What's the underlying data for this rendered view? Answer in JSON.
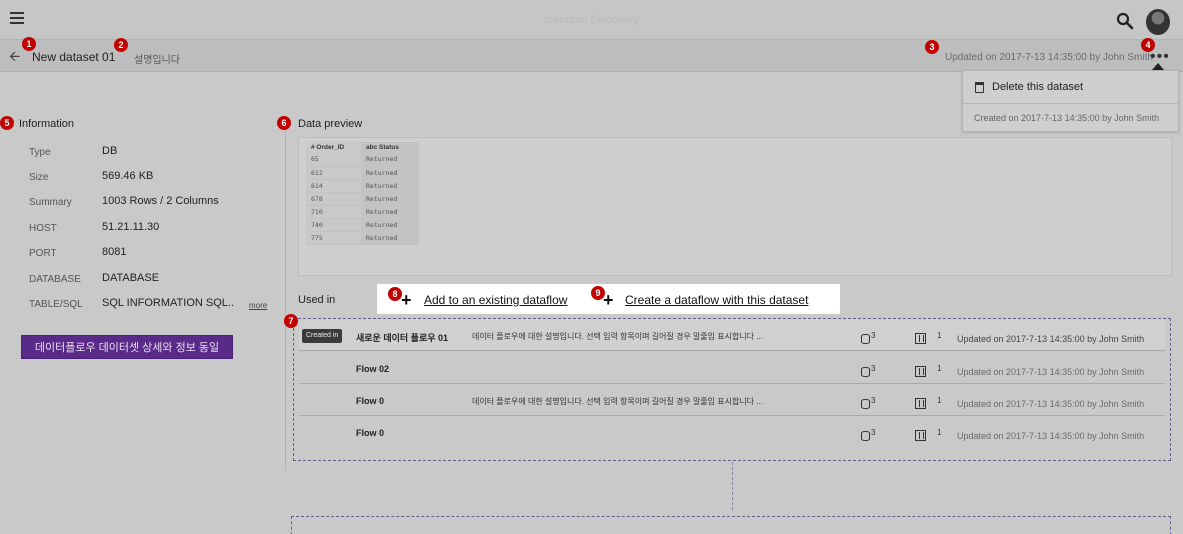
{
  "app": {
    "brand": "metatron Discovery"
  },
  "header": {
    "title": "New dataset 01",
    "description": "설명입니다",
    "updated": "Updated on 2017-7-13 14:35:00 by John Smith",
    "more": "•••"
  },
  "badges": [
    "1",
    "2",
    "3",
    "4",
    "5",
    "6",
    "7",
    "8",
    "9"
  ],
  "menu": {
    "delete_label": "Delete this dataset",
    "created": "Created on 2017-7-13 14:35:00 by John Smith"
  },
  "info": {
    "title": "Information",
    "rows": [
      {
        "label": "Type",
        "value": "DB"
      },
      {
        "label": "Size",
        "value": "569.46 KB"
      },
      {
        "label": "Summary",
        "value": "1003 Rows / 2 Columns"
      },
      {
        "label": "HOST",
        "value": "51.21.11.30"
      },
      {
        "label": "PORT",
        "value": "8081"
      },
      {
        "label": "DATABASE",
        "value": "DATABASE"
      },
      {
        "label": "TABLE/SQL",
        "value": "SQL INFORMATION SQL.."
      }
    ],
    "more_link": "more",
    "button": "데이터플로우 데이터셋 상세와 정보 동일"
  },
  "preview": {
    "title": "Data preview",
    "columns": [
      "# Order_ID",
      "abc Status"
    ],
    "rows": [
      [
        "65",
        "Returned"
      ],
      [
        "612",
        "Returned"
      ],
      [
        "614",
        "Returned"
      ],
      [
        "678",
        "Returned"
      ],
      [
        "710",
        "Returned"
      ],
      [
        "740",
        "Returned"
      ],
      [
        "775",
        "Returned"
      ]
    ]
  },
  "used_in": {
    "title": "Used in",
    "add_existing": "Add to an existing dataflow",
    "create_new": "Create a dataflow with this dataset",
    "created_tag": "Created in",
    "flows": [
      {
        "name": "새로운 데이터 플로우 01",
        "desc": "데이터 플로우에 대한 설명입니다. 선택 입력 항목이며 길어질 경우 말줄임 표시합니다 ...",
        "datasets": "3",
        "tables": "1",
        "updated": "Updated on 2017-7-13 14:35:00 by John Smith"
      },
      {
        "name": "Flow 02",
        "desc": "",
        "datasets": "3",
        "tables": "1",
        "updated": "Updated on 2017-7-13 14:35:00 by John Smith"
      },
      {
        "name": "Flow 0",
        "desc": "데이터 플로우에 대한 설명입니다. 선택 입력 항목이며 길어질 경우 말줄임 표시합니다 ...",
        "datasets": "3",
        "tables": "1",
        "updated": "Updated on 2017-7-13 14:35:00 by John Smith"
      },
      {
        "name": "Flow 0",
        "desc": "",
        "datasets": "3",
        "tables": "1",
        "updated": "Updated on 2017-7-13 14:35:00 by John Smith"
      }
    ]
  }
}
